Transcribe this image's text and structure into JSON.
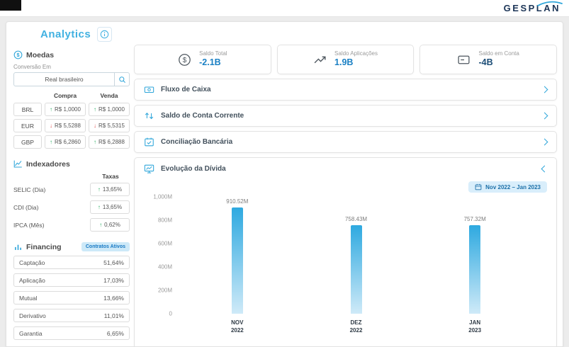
{
  "topbar": {
    "brand": "GESPLAN"
  },
  "page": {
    "title": "Analytics"
  },
  "sidebar": {
    "moedas": {
      "title": "Moedas",
      "icon": "coin-icon",
      "conversion_label": "Conversão Em",
      "search_value": "Real brasileiro",
      "search_icon": "search-icon",
      "columns": {
        "compra": "Compra",
        "venda": "Venda"
      },
      "rows": [
        {
          "code": "BRL",
          "dir": "up",
          "compra": "R$ 1,0000",
          "venda": "R$ 1,0000"
        },
        {
          "code": "EUR",
          "dir": "down",
          "compra": "R$ 5,5288",
          "venda": "R$ 5,5315"
        },
        {
          "code": "GBP",
          "dir": "up",
          "compra": "R$ 6,2860",
          "venda": "R$ 6,2888"
        }
      ]
    },
    "indexadores": {
      "title": "Indexadores",
      "icon": "line-chart-icon",
      "column": "Taxas",
      "rows": [
        {
          "label": "SELIC (Dia)",
          "dir": "up",
          "value": "13,65%"
        },
        {
          "label": "CDI (Dia)",
          "dir": "up",
          "value": "13,65%"
        },
        {
          "label": "IPCA (Mês)",
          "dir": "up",
          "value": "0,62%"
        }
      ]
    },
    "financing": {
      "title": "Financing",
      "icon": "bars-icon",
      "badge": "Contratos Ativos",
      "rows": [
        {
          "label": "Captação",
          "value": "51,64%"
        },
        {
          "label": "Aplicação",
          "value": "17,03%"
        },
        {
          "label": "Mutual",
          "value": "13,66%"
        },
        {
          "label": "Derivativo",
          "value": "11,01%"
        },
        {
          "label": "Garantia",
          "value": "6,65%"
        }
      ]
    }
  },
  "summary": {
    "cards": [
      {
        "label": "Saldo Total",
        "value": "-2.1B",
        "color": "#1b80c4",
        "icon": "dollar-circle-icon"
      },
      {
        "label": "Saldo Aplicações",
        "value": "1.9B",
        "color": "#1b80c4",
        "icon": "trend-up-icon"
      },
      {
        "label": "Saldo em Conta",
        "value": "-4B",
        "color": "#1d4e77",
        "icon": "account-card-icon"
      }
    ]
  },
  "accordions": [
    {
      "label": "Fluxo de Caixa",
      "icon": "banknote-icon"
    },
    {
      "label": "Saldo de Conta Corrente",
      "icon": "transfer-arrows-icon"
    },
    {
      "label": "Conciliação Bancária",
      "icon": "calendar-check-icon"
    }
  ],
  "debt_panel": {
    "title": "Evolução da Dívida",
    "icon": "monitor-chart-icon",
    "date_range": "Nov 2022 – Jan 2023",
    "date_icon": "calendar-icon"
  },
  "chart_data": {
    "type": "bar",
    "title": "Evolução da Dívida",
    "categories": [
      "NOV 2022",
      "DEZ 2022",
      "JAN 2023"
    ],
    "x_labels": [
      {
        "l1": "NOV",
        "l2": "2022"
      },
      {
        "l1": "DEZ",
        "l2": "2022"
      },
      {
        "l1": "JAN",
        "l2": "2023"
      }
    ],
    "values": [
      910.52,
      758.43,
      757.32
    ],
    "value_labels": [
      "910.52M",
      "758.43M",
      "757.32M"
    ],
    "unit": "M",
    "ylim": [
      0,
      1000
    ],
    "yticks": [
      "1,000M",
      "800M",
      "600M",
      "400M",
      "200M",
      "0"
    ],
    "grid": false,
    "legend": false,
    "bar_color_top": "#2ea9e0",
    "bar_color_bottom": "#cfeaf8"
  }
}
